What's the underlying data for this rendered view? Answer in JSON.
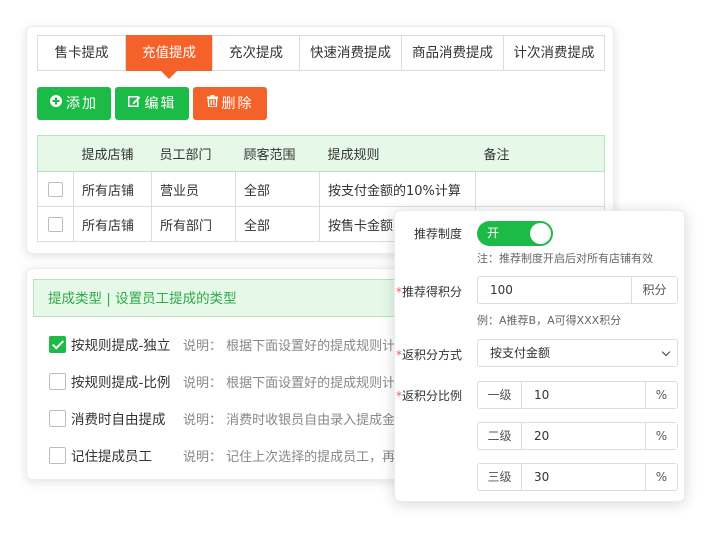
{
  "tabs": [
    {
      "label": "售卡提成",
      "active": false
    },
    {
      "label": "充值提成",
      "active": true
    },
    {
      "label": "充次提成",
      "active": false
    },
    {
      "label": "快速消费提成",
      "active": false
    },
    {
      "label": "商品消费提成",
      "active": false
    },
    {
      "label": "计次消费提成",
      "active": false
    }
  ],
  "toolbar": {
    "add_label": "添加",
    "edit_label": "编辑",
    "delete_label": "删除"
  },
  "colors": {
    "accent_green": "#1cbb47",
    "accent_orange": "#f46129",
    "header_green_bg": "#e6f9e8"
  },
  "table": {
    "headers": [
      "",
      "提成店铺",
      "员工部门",
      "顾客范围",
      "提成规则",
      "备注"
    ],
    "rows": [
      [
        "所有店铺",
        "营业员",
        "全部",
        "按支付金额的10%计算",
        ""
      ],
      [
        "所有店铺",
        "所有部门",
        "全部",
        "按售卡金额",
        ""
      ]
    ]
  },
  "types": {
    "header": "提成类型 | 设置员工提成的类型",
    "items": [
      {
        "label": "按规则提成-独立",
        "checked": true,
        "desc": "说明： 根据下面设置好的提成规则计"
      },
      {
        "label": "按规则提成-比例",
        "checked": false,
        "desc": "说明： 根据下面设置好的提成规则计"
      },
      {
        "label": "消费时自由提成",
        "checked": false,
        "desc": "说明： 消费时收银员自由录入提成金"
      },
      {
        "label": "记住提成员工",
        "checked": false,
        "desc": "说明： 记住上次选择的提成员工，再"
      }
    ]
  },
  "popup": {
    "recommend_label": "推荐制度",
    "toggle_text": "开",
    "recommend_hint": "注：推荐制度开启后对所有店铺有效",
    "points_label": "推荐得积分",
    "points_value": "100",
    "points_unit": "积分",
    "points_hint": "例：A推荐B，A可得XXX积分",
    "method_label": "返积分方式",
    "method_value": "按支付金额",
    "ratio_label": "返积分比例",
    "levels": [
      {
        "name": "一级",
        "value": "10",
        "unit": "%"
      },
      {
        "name": "二级",
        "value": "20",
        "unit": "%"
      },
      {
        "name": "三级",
        "value": "30",
        "unit": "%"
      }
    ]
  }
}
